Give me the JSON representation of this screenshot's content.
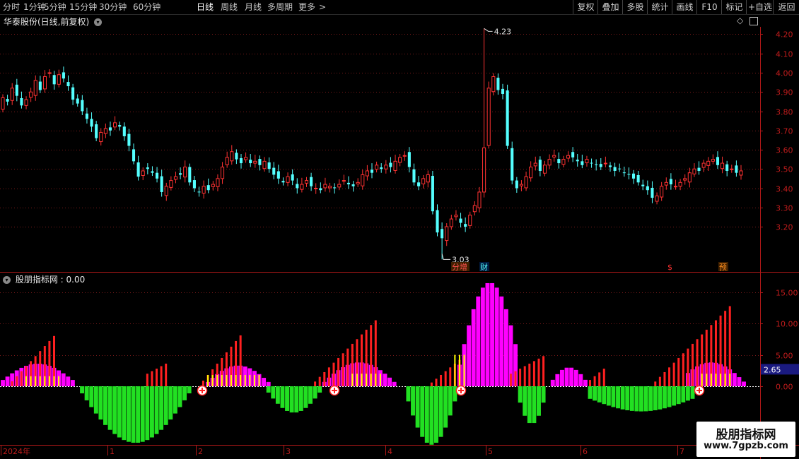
{
  "toolbar": {
    "periods": [
      "分时",
      "1分钟",
      "5分钟",
      "15分钟",
      "30分钟",
      "60分钟",
      "日线",
      "周线",
      "月线",
      "多周期",
      "更多"
    ],
    "active_period": "日线",
    "more_arrow": ">",
    "right_buttons": [
      "复权",
      "叠加",
      "多股",
      "统计",
      "画线",
      "F10",
      "标记",
      "+自选",
      "返回"
    ]
  },
  "main_chart": {
    "title": "华泰股份(日线,前复权)",
    "y_ticks": [
      "4.20",
      "4.10",
      "4.00",
      "3.90",
      "3.80",
      "3.70",
      "3.60",
      "3.50",
      "3.40",
      "3.30",
      "3.20"
    ],
    "high_label": "4.23",
    "low_label": "3.03",
    "event_markers": [
      "分增",
      "财",
      "$",
      "预"
    ]
  },
  "indicator": {
    "title": "股朋指标网",
    "value_label": ": 0.00",
    "y_ticks": [
      "15.00",
      "10.00",
      "5.00",
      "0.00"
    ],
    "current_value": "2.65"
  },
  "x_axis": {
    "labels": [
      "2024年",
      "1",
      "2",
      "3",
      "4",
      "5",
      "6",
      "7"
    ]
  },
  "watermark": {
    "title": "股朋指标网",
    "url": "www.7gpzb.com"
  },
  "colors": {
    "up": "#ff3232",
    "down": "#54ffff",
    "magenta": "#ff00ff",
    "green": "#22e022",
    "red_bar": "#ff2020",
    "yellow": "#ffff00",
    "grid": "#7a1a1a",
    "axis": "#b01818"
  },
  "chart_data": {
    "type": "candlestick",
    "ylim": [
      3.0,
      4.3
    ],
    "high": 4.23,
    "low": 3.03,
    "indicator_ylim": [
      -9,
      18
    ],
    "indicator_current": 2.65
  }
}
